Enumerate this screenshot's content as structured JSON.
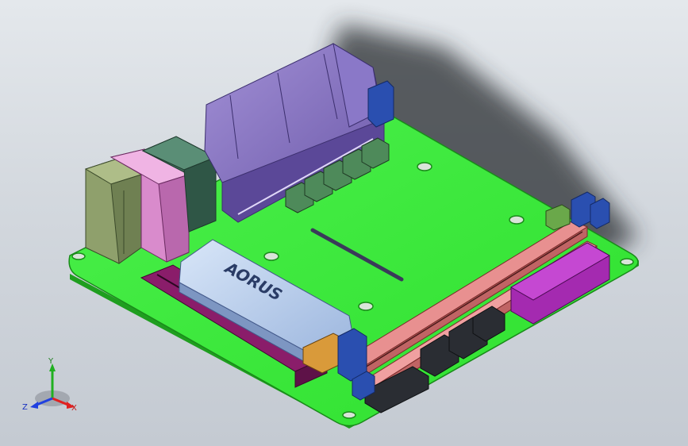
{
  "scene": {
    "background_top": "#e4e8ec",
    "background_bottom": "#c4cad2",
    "board_color": "#33ee33",
    "board_edge_color": "#1f9e1f"
  },
  "heatsink": {
    "brand_text": "AORUS",
    "color": "#b9cfee"
  },
  "triad": {
    "x_label": "X",
    "y_label": "Y",
    "z_label": "Z",
    "x_color": "#e02020",
    "y_color": "#20b020",
    "z_color": "#2040e0"
  }
}
